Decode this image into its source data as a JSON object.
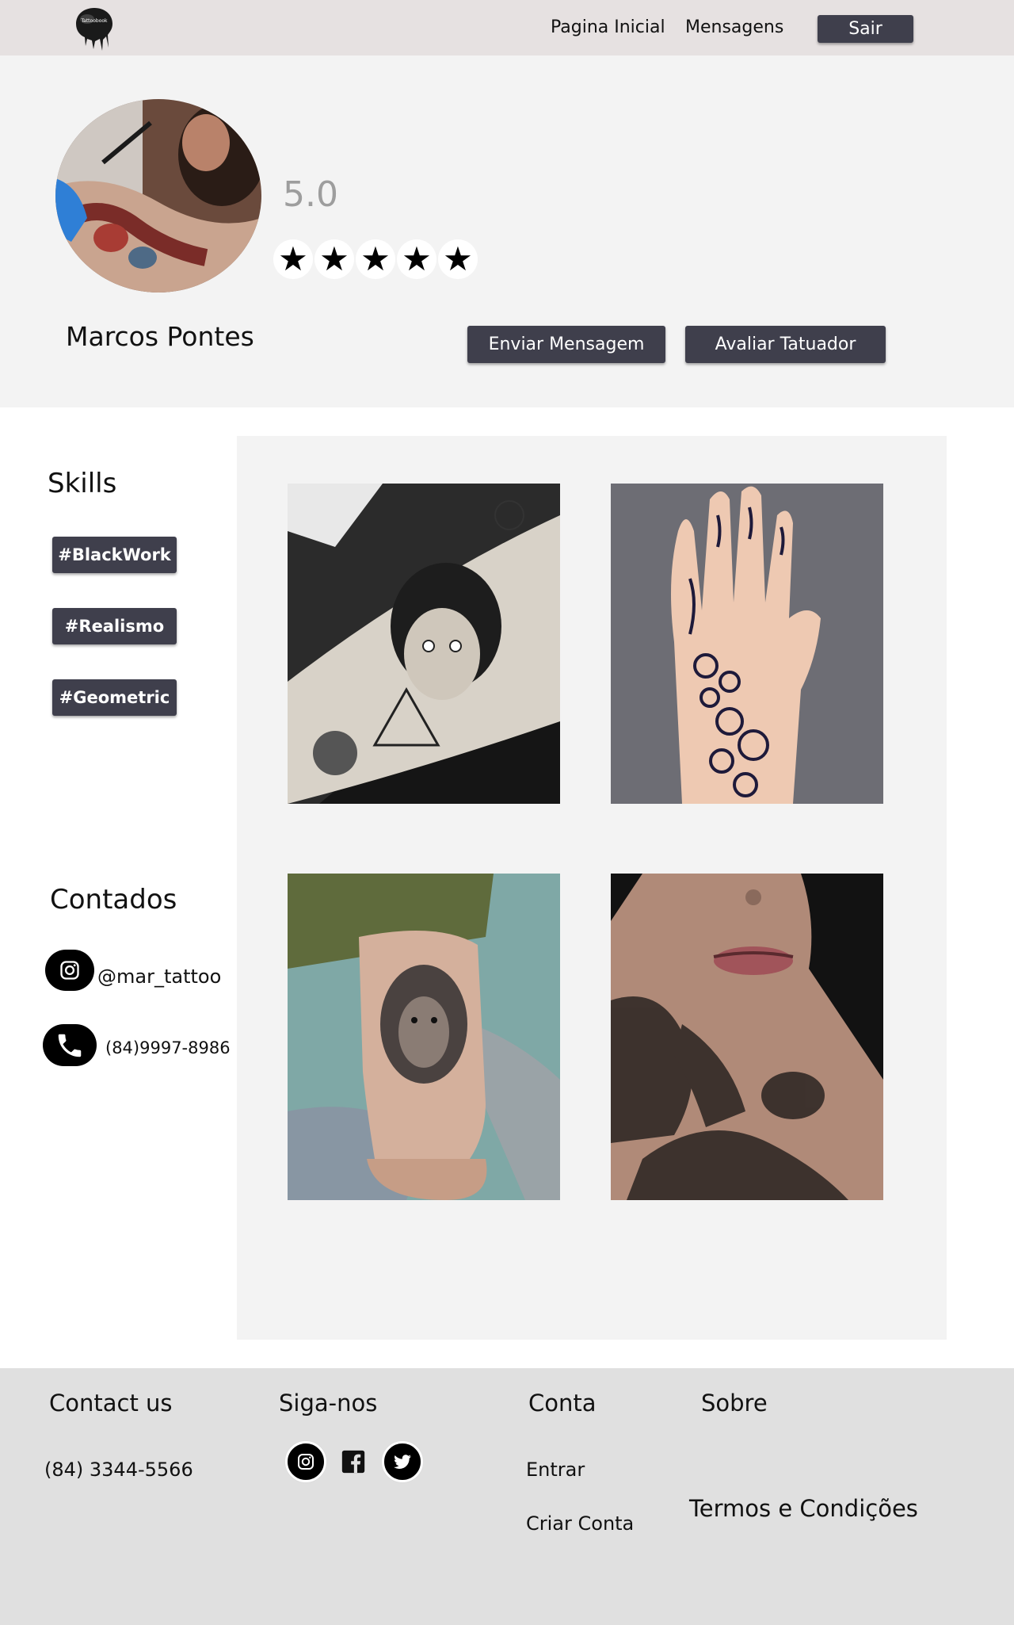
{
  "nav": {
    "home_label": "Pagina Inicial",
    "messages_label": "Mensagens",
    "logout_label": "Sair"
  },
  "profile": {
    "rating": "5.0",
    "stars": 5,
    "name": "Marcos Pontes",
    "send_message_label": "Enviar Mensagem",
    "rate_artist_label": "Avaliar Tatuador"
  },
  "skills": {
    "title": "Skills",
    "items": [
      "#BlackWork",
      "#Realismo",
      "#Geometric"
    ]
  },
  "contacts": {
    "title": "Contados",
    "instagram": "@mar_tattoo",
    "phone": "(84)9997-8986"
  },
  "gallery": {
    "photos": [
      "tattoo-photo-blackwork-arm",
      "tattoo-photo-henna-hand",
      "tattoo-photo-lion-forearm",
      "tattoo-photo-neck-chest"
    ]
  },
  "footer": {
    "contact_title": "Contact us",
    "contact_phone": "(84) 3344-5566",
    "follow_title": "Siga-nos",
    "account_title": "Conta",
    "account_login": "Entrar",
    "account_signup": "Criar Conta",
    "about_title": "Sobre",
    "terms_label": "Termos e Condições"
  },
  "colors": {
    "nav_bg": "#e6e1e1",
    "button_bg": "#3f3f4c",
    "section_bg": "#f3f3f3",
    "footer_bg": "#e0e0e0"
  }
}
